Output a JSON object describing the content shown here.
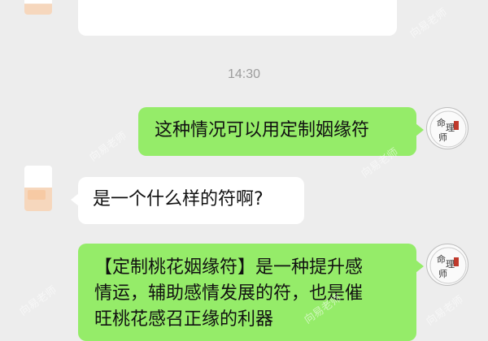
{
  "chat": {
    "timestamp": "14:30",
    "messages": [
      {
        "side": "right",
        "text": "这种情况可以用定制姻缘符"
      },
      {
        "side": "left",
        "text": "是一个什么样的符啊?"
      },
      {
        "side": "right",
        "lines": [
          "【定制桃花姻缘符】是一种提升感",
          "情运，辅助感情发展的符，也是催",
          "旺桃花感召正缘的利器"
        ]
      }
    ]
  },
  "avatar_seal": {
    "line1": "命",
    "line2": "理",
    "line3": "师"
  },
  "watermark": "向易老师",
  "colors": {
    "background": "#ededed",
    "sent_bubble": "#95ec69",
    "received_bubble": "#ffffff",
    "timestamp": "#9c9c9c"
  }
}
